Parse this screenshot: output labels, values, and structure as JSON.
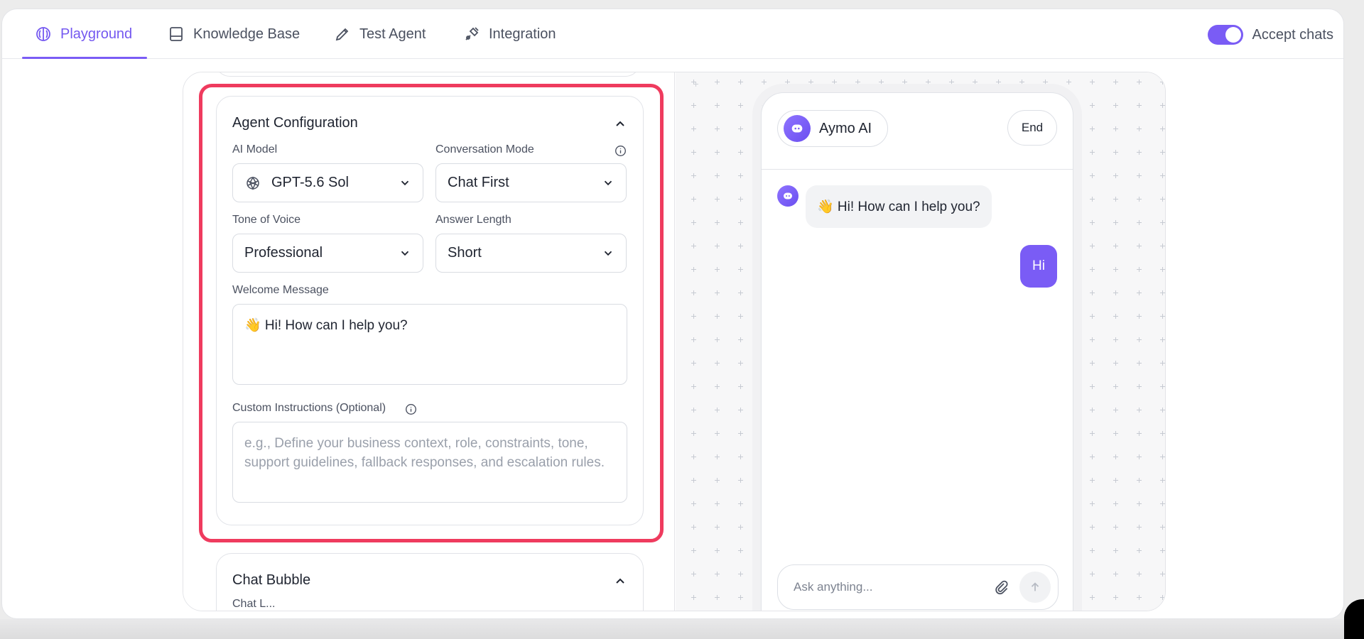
{
  "nav": {
    "tabs": [
      {
        "label": "Playground",
        "icon": "brain-icon",
        "active": true
      },
      {
        "label": "Knowledge Base",
        "icon": "book-icon",
        "active": false
      },
      {
        "label": "Test Agent",
        "icon": "pencil-icon",
        "active": false
      },
      {
        "label": "Integration",
        "icon": "plug-icon",
        "active": false
      }
    ],
    "accept_chats_label": "Accept chats",
    "accept_chats_enabled": true
  },
  "config": {
    "title": "Agent Configuration",
    "ai_model_label": "AI Model",
    "ai_model_value": "GPT-5.6 Sol",
    "conversation_mode_label": "Conversation Mode",
    "conversation_mode_value": "Chat First",
    "tone_label": "Tone of Voice",
    "tone_value": "Professional",
    "answer_length_label": "Answer Length",
    "answer_length_value": "Short",
    "welcome_label": "Welcome Message",
    "welcome_value": "👋 Hi! How can I help you?",
    "custom_label": "Custom Instructions (Optional)",
    "custom_placeholder": "e.g., Define your business context, role, constraints, tone, support guidelines, fallback responses, and escalation rules."
  },
  "bubble": {
    "title": "Chat Bubble",
    "sub": "Chat L..."
  },
  "preview": {
    "agent_name": "Aymo AI",
    "end_label": "End",
    "bot_message": "👋 Hi! How can I help you?",
    "user_message": "Hi",
    "composer_placeholder": "Ask anything..."
  },
  "colors": {
    "accent": "#7a5cf5",
    "highlight": "#ef3b5e"
  }
}
